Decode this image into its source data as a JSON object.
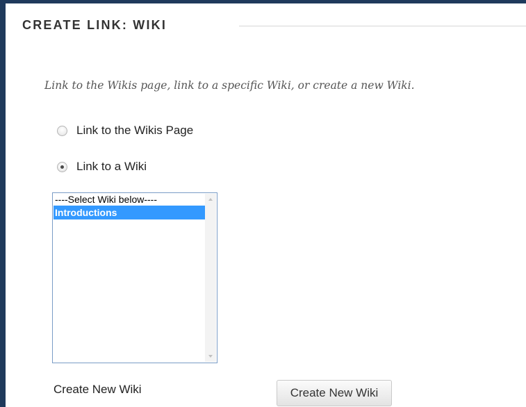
{
  "section": {
    "title": "CREATE LINK: WIKI",
    "instructions": "Link to the Wikis page, link to a specific Wiki, or create a new Wiki."
  },
  "options": {
    "link_wikis_page": {
      "label": "Link to the Wikis Page",
      "checked": false
    },
    "link_to_wiki": {
      "label": "Link to a Wiki",
      "checked": true
    }
  },
  "wiki_select": {
    "options": [
      "----Select Wiki below----",
      "Introductions"
    ],
    "selected": "Introductions"
  },
  "create_new_wiki": {
    "label": "Create New Wiki",
    "button_label": "Create New Wiki"
  },
  "colors": {
    "frame": "#1f3a5c",
    "selection": "#3399ff",
    "listbox_border": "#7a9cc6"
  }
}
